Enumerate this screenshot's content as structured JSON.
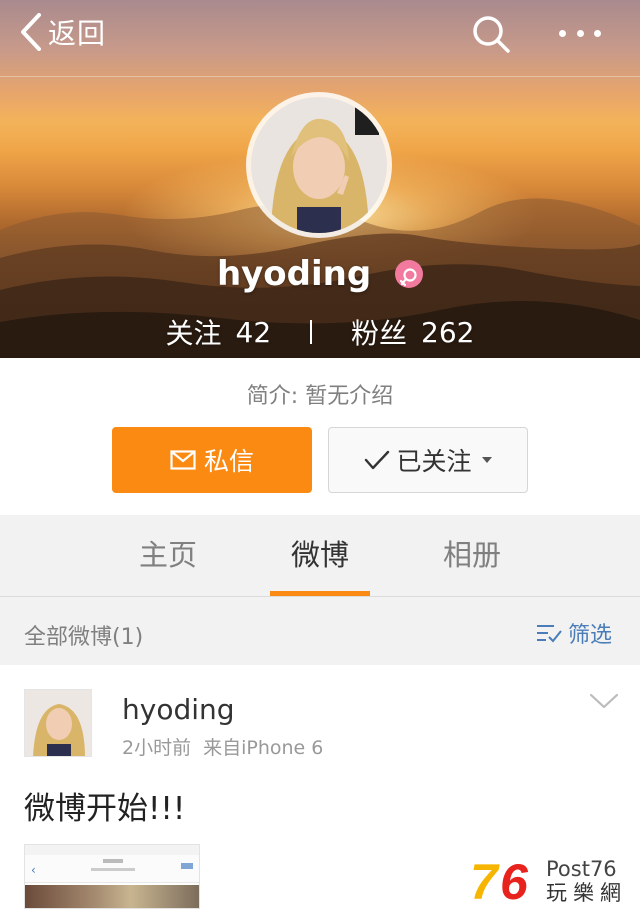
{
  "nav": {
    "back_label": "返回",
    "icons": {
      "back": "chevron-left-icon",
      "search": "search-icon",
      "more": "more-dots-icon"
    }
  },
  "profile": {
    "name": "hyoding",
    "gender_badge": "female-icon",
    "following_label": "关注",
    "following_count": "42",
    "followers_label": "粉丝",
    "followers_count": "262",
    "bio": "简介: 暂无介绍"
  },
  "actions": {
    "message_label": "私信",
    "follow_label": "已关注"
  },
  "tabs": [
    {
      "label": "主页",
      "active": false
    },
    {
      "label": "微博",
      "active": true
    },
    {
      "label": "相册",
      "active": false
    }
  ],
  "filter": {
    "all_label": "全部微博(1)",
    "filter_label": "筛选"
  },
  "post": {
    "author": "hyoding",
    "time": "2小时前",
    "source": "来自iPhone 6",
    "text": "微博开始!!!"
  },
  "watermark": {
    "digits": "76",
    "brand": "Post76",
    "subtitle": "玩樂網"
  },
  "colors": {
    "accent": "#fb8a13",
    "link": "#4a7db8",
    "gender": "#f27a9f"
  }
}
